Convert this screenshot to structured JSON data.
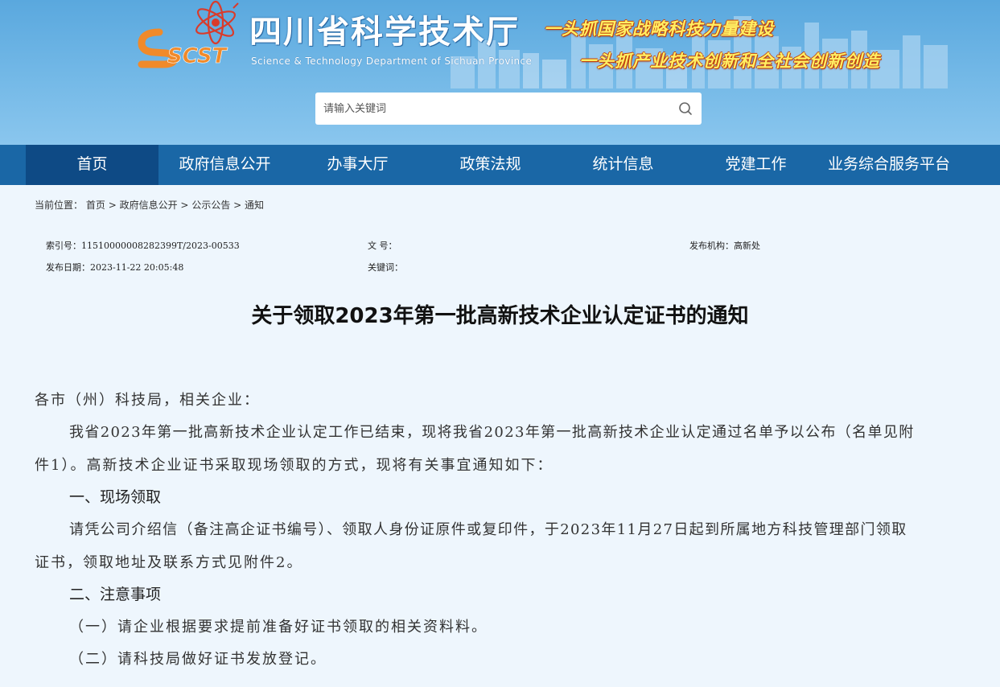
{
  "header": {
    "logo_text": "SCST",
    "title": "四川省科学技术厅",
    "subtitle": "Science & Technology Department of Sichuan Province",
    "slogan_1": "一头抓国家战略科技力量建设",
    "slogan_2": "一头抓产业技术创新和全社会创新创造"
  },
  "search": {
    "placeholder": "请输入关键词",
    "icon": "search-icon"
  },
  "nav": {
    "items": [
      {
        "label": "首页",
        "active": true
      },
      {
        "label": "政府信息公开"
      },
      {
        "label": "办事大厅"
      },
      {
        "label": "政策法规"
      },
      {
        "label": "统计信息"
      },
      {
        "label": "党建工作"
      },
      {
        "label": "业务综合服务平台"
      }
    ]
  },
  "breadcrumb": {
    "prefix": "当前位置：",
    "items": [
      "首页",
      "政府信息公开",
      "公示公告",
      "通知"
    ],
    "separator": ">"
  },
  "meta": {
    "index_label": "索引号：",
    "index_value": "11510000008282399T/2023-00533",
    "doc_no_label": "文 号：",
    "doc_no_value": "",
    "publisher_label": "发布机构：",
    "publisher_value": "高新处",
    "date_label": "发布日期：",
    "date_value": "2023-11-22 20:05:48",
    "keywords_label": "关键词：",
    "keywords_value": ""
  },
  "article": {
    "title": "关于领取2023年第一批高新技术企业认定证书的通知",
    "salutation": "各市（州）科技局，相关企业：",
    "p1_line1": "我省2023年第一批高新技术企业认定工作已结束，现将我省2023年第一批高新技术企业认定通过名单予以公布（名单见附",
    "p1_line2": "件1）。高新技术企业证书采取现场领取的方式，现将有关事宜通知如下：",
    "h1": "一、现场领取",
    "p2_line1": "请凭公司介绍信（备注高企证书编号）、领取人身份证原件或复印件，于2023年11月27日起到所属地方科技管理部门领取",
    "p2_line2": "证书，领取地址及联系方式见附件2。",
    "h2": "二、注意事项",
    "item1": "（一）请企业根据要求提前准备好证书领取的相关资料料。",
    "item2": "（二）请科技局做好证书发放登记。"
  },
  "colors": {
    "banner": "#5aa8de",
    "nav": "#1a67a6",
    "nav_active": "#0e4a85",
    "page_bg": "#eef6fd",
    "slogan": "#ffef63"
  }
}
